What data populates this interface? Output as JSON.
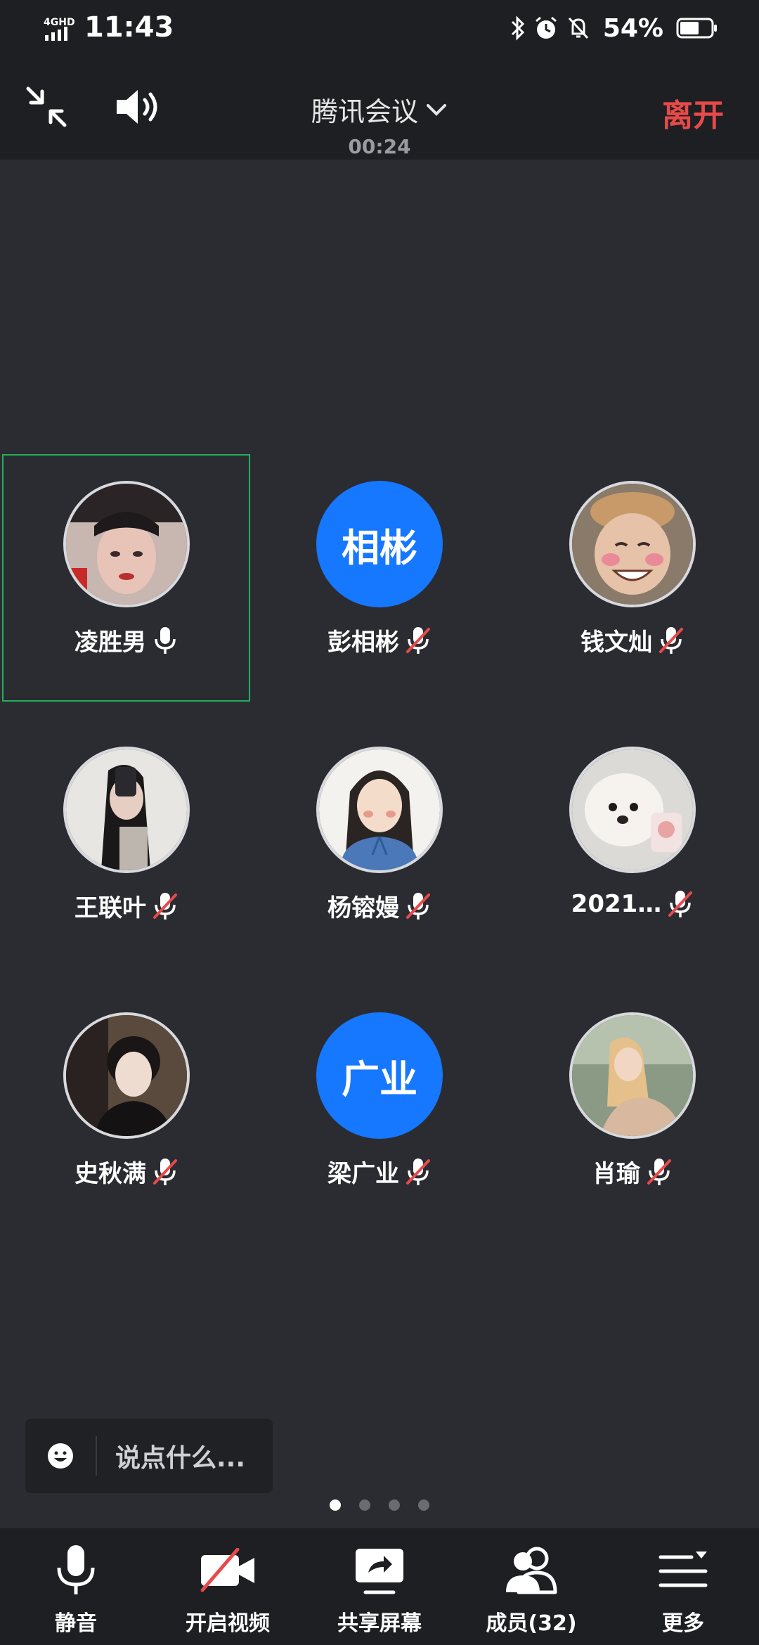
{
  "status_bar": {
    "network": "4GHD",
    "time": "11:43",
    "battery_percent": "54%",
    "icons": [
      "bluetooth-icon",
      "alarm-icon",
      "mute-notification-icon",
      "battery-icon"
    ]
  },
  "header": {
    "title": "腾讯会议",
    "duration": "00:24",
    "leave_label": "离开",
    "leave_color": "#e84a4a"
  },
  "participants": [
    {
      "name": "凌胜男",
      "avatar_type": "photo",
      "avatar_text": "",
      "muted": false,
      "speaking": true
    },
    {
      "name": "彭相彬",
      "avatar_type": "text",
      "avatar_text": "相彬",
      "muted": true,
      "speaking": false
    },
    {
      "name": "钱文灿",
      "avatar_type": "photo",
      "avatar_text": "",
      "muted": true,
      "speaking": false
    },
    {
      "name": "王联叶",
      "avatar_type": "photo",
      "avatar_text": "",
      "muted": true,
      "speaking": false
    },
    {
      "name": "杨镕嫚",
      "avatar_type": "photo",
      "avatar_text": "",
      "muted": true,
      "speaking": false
    },
    {
      "name": "2021…",
      "avatar_type": "photo",
      "avatar_text": "",
      "muted": true,
      "speaking": false
    },
    {
      "name": "史秋满",
      "avatar_type": "photo",
      "avatar_text": "",
      "muted": true,
      "speaking": false
    },
    {
      "name": "梁广业",
      "avatar_type": "text",
      "avatar_text": "广业",
      "muted": true,
      "speaking": false
    },
    {
      "name": "肖瑜",
      "avatar_type": "photo",
      "avatar_text": "",
      "muted": true,
      "speaking": false
    }
  ],
  "chat": {
    "placeholder": "说点什么..."
  },
  "pagination": {
    "current": 1,
    "total": 4
  },
  "toolbar": [
    {
      "label": "静音",
      "icon": "microphone-icon"
    },
    {
      "label": "开启视频",
      "icon": "video-off-icon"
    },
    {
      "label": "共享屏幕",
      "icon": "share-screen-icon"
    },
    {
      "label": "成员(32)",
      "icon": "members-icon"
    },
    {
      "label": "更多",
      "icon": "more-menu-icon"
    }
  ],
  "colors": {
    "background": "#2b2c31",
    "bar": "#1e1f22",
    "accent_blue": "#1677ff",
    "speaking_green": "#22b05a",
    "muted_red": "#e84a4a"
  }
}
